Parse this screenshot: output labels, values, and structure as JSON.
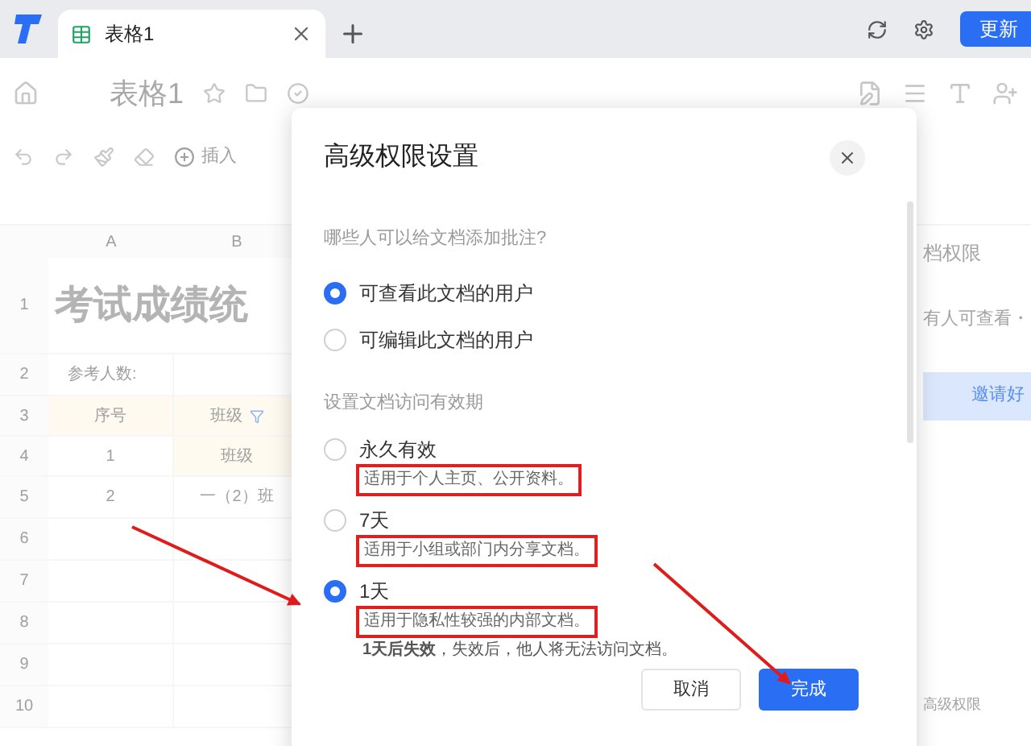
{
  "browser_tabs": [
    {
      "label": "表格1",
      "selected": true
    }
  ],
  "update_button": "更新",
  "doc_title": "表格1",
  "toolbar": {
    "insert": "插入"
  },
  "sheet": {
    "columns": [
      "A",
      "B"
    ],
    "rows": [
      {
        "number": "1",
        "a": "考试成绩统",
        "kind": "title"
      },
      {
        "number": "2",
        "a": "参考人数:",
        "kind": "plain"
      },
      {
        "number": "3",
        "a": "序号",
        "b": "班级",
        "kind": "header"
      },
      {
        "number": "4",
        "a": "1",
        "b": "班级",
        "kind": "subheader"
      },
      {
        "number": "5",
        "a": "2",
        "b": "一（2）班",
        "kind": "plain"
      },
      {
        "number": "6",
        "kind": "plain"
      },
      {
        "number": "7",
        "kind": "plain"
      },
      {
        "number": "8",
        "kind": "plain"
      },
      {
        "number": "9",
        "kind": "plain"
      },
      {
        "number": "10",
        "kind": "plain"
      }
    ]
  },
  "side_panel": {
    "title": "档权限",
    "summary": "有人可查看・",
    "invite_button": "邀请好",
    "footer": "高级权限"
  },
  "dialog": {
    "title": "高级权限设置",
    "comment_question": "哪些人可以给文档添加批注?",
    "comment_options": [
      {
        "label": "可查看此文档的用户",
        "selected": true
      },
      {
        "label": "可编辑此文档的用户",
        "selected": false
      }
    ],
    "validity_label": "设置文档访问有效期",
    "validity_options": [
      {
        "label": "永久有效",
        "description": "适用于个人主页、公开资料。",
        "highlighted": true,
        "selected": false
      },
      {
        "label": "7天",
        "description": "适用于小组或部门内分享文档。",
        "highlighted": true,
        "selected": false
      },
      {
        "label": "1天",
        "description": "适用于隐私性较强的内部文档。",
        "highlighted": true,
        "selected": true,
        "note": "**1天后失效**，失效后，他人将无法访问文档。"
      }
    ],
    "cancel_button": "取消",
    "confirm_button": "完成"
  }
}
